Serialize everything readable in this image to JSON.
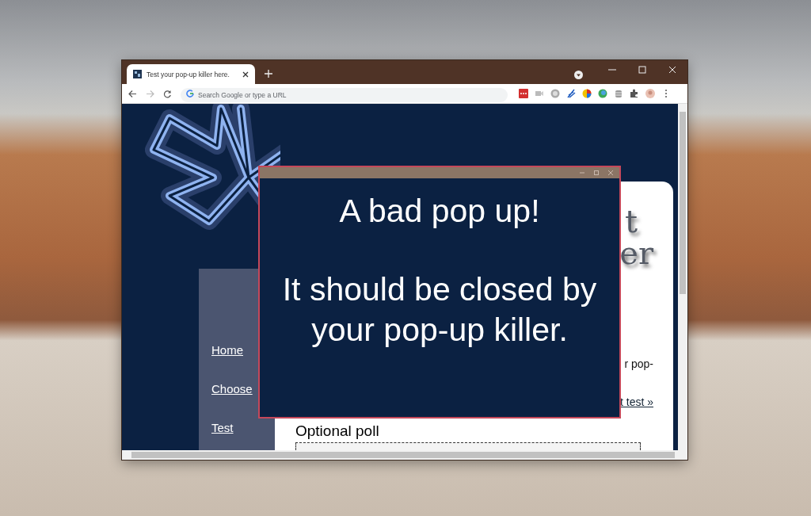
{
  "browser": {
    "tab": {
      "title": "Test your pop-up killer here.",
      "selected": true
    },
    "address_bar": {
      "placeholder": "Search Google or type a URL"
    }
  },
  "page": {
    "logo_letters": [
      "t",
      "er"
    ],
    "nav": [
      {
        "label": "Home"
      },
      {
        "label": "Choose"
      },
      {
        "label": "Test"
      }
    ],
    "intro_fragment": "r pop-",
    "start_link": "t test »",
    "poll_heading": "Optional poll"
  },
  "popup": {
    "lines": [
      "A bad pop up!",
      "It should be closed by your pop-up killer."
    ]
  }
}
